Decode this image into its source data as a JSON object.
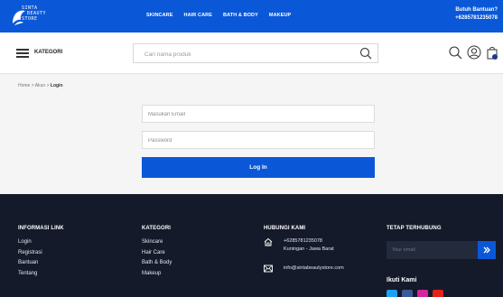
{
  "brand": {
    "logo_text": [
      "SINTA",
      "BEAUTY",
      "STORE"
    ],
    "accent": "#0a58d8",
    "footer_bg": "#141a2a"
  },
  "topnav": [
    "SKINCARE",
    "HAIR CARE",
    "BATH & BODY",
    "MAKEUP"
  ],
  "help": {
    "title": "Butuh Bantuan?",
    "phone": "+6285781235078"
  },
  "header": {
    "menu_label": "KATEGORI",
    "search_placeholder": "Cari nama produk",
    "icons": [
      "search-icon",
      "user-icon",
      "shopping-bag-icon"
    ]
  },
  "breadcrumb": {
    "home": "Home",
    "sep": ">",
    "account": "Akun",
    "current": "Login"
  },
  "login": {
    "email_placeholder": "Masukan Email",
    "password_placeholder": "Password",
    "button": "Log In"
  },
  "footer": {
    "info": {
      "title": "INFORMASI LINK",
      "items": [
        "Login",
        "Registrasi",
        "Bantuan",
        "Tentang"
      ]
    },
    "kategori": {
      "title": "KATEGORI",
      "items": [
        "Skincare",
        "Hair Care",
        "Bath & Body",
        "Makeup"
      ]
    },
    "contact": {
      "title": "HUBUNGI KAMI",
      "phone": "+6285781235078",
      "location": "Kuningan - Jawa Barat",
      "email": "info@sintabeautystore.com"
    },
    "newsletter": {
      "title": "TETAP TERHUBUNG",
      "placeholder": "Your email"
    },
    "follow": {
      "title": "Ikuti Kami",
      "networks": [
        "twitter-icon",
        "facebook-icon",
        "instagram-icon",
        "youtube-icon"
      ]
    }
  }
}
